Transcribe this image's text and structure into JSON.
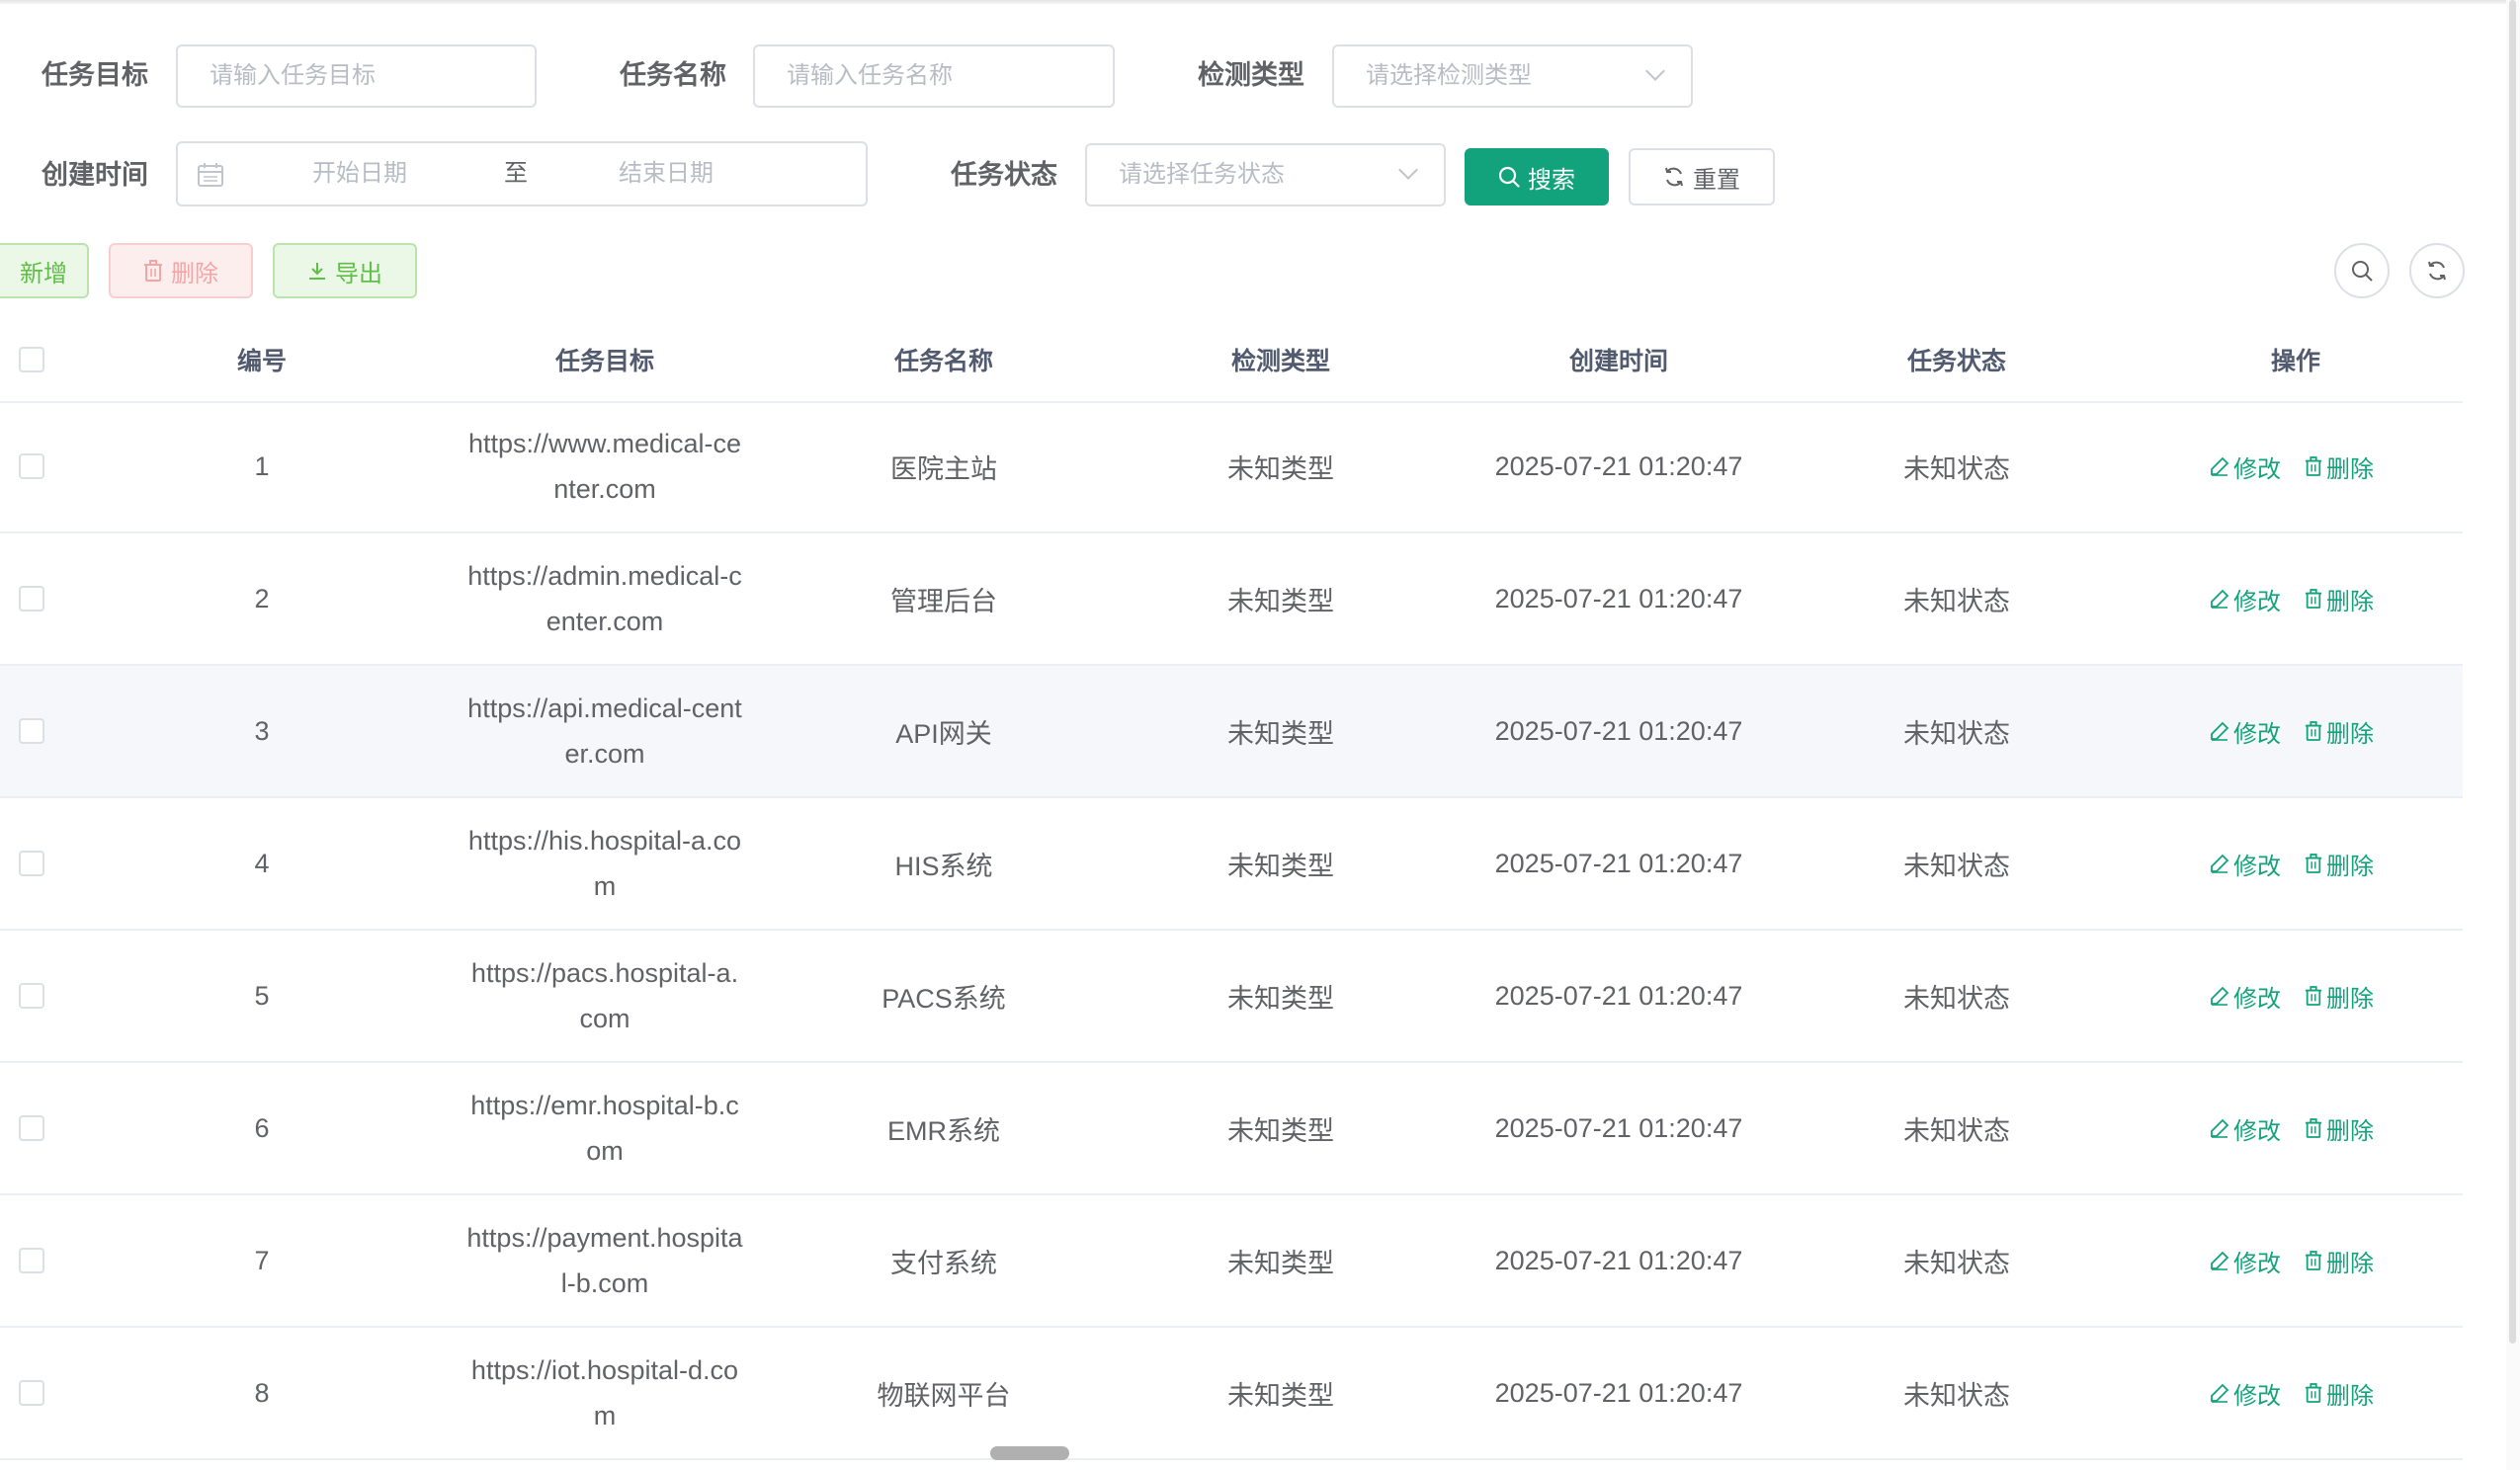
{
  "search_form": {
    "task_target_label": "任务目标",
    "task_target_placeholder": "请输入任务目标",
    "task_name_label": "任务名称",
    "task_name_placeholder": "请输入任务名称",
    "detect_type_label": "检测类型",
    "detect_type_placeholder": "请选择检测类型",
    "create_time_label": "创建时间",
    "start_date_placeholder": "开始日期",
    "range_separator": "至",
    "end_date_placeholder": "结束日期",
    "task_status_label": "任务状态",
    "task_status_placeholder": "请选择任务状态",
    "search_button": "搜索",
    "reset_button": "重置"
  },
  "toolbar": {
    "add_button": "新增",
    "delete_button": "删除",
    "export_button": "导出"
  },
  "table": {
    "columns": [
      "编号",
      "任务目标",
      "任务名称",
      "检测类型",
      "创建时间",
      "任务状态",
      "操作"
    ],
    "edit_label": "修改",
    "delete_label": "删除",
    "rows": [
      {
        "id": "1",
        "target": "https://www.medical-center.com",
        "target_lines": [
          "https://www.medical-ce",
          "nter.com"
        ],
        "name": "医院主站",
        "type": "未知类型",
        "created": "2025-07-21 01:20:47",
        "status": "未知状态"
      },
      {
        "id": "2",
        "target": "https://admin.medical-center.com",
        "target_lines": [
          "https://admin.medical-c",
          "enter.com"
        ],
        "name": "管理后台",
        "type": "未知类型",
        "created": "2025-07-21 01:20:47",
        "status": "未知状态"
      },
      {
        "id": "3",
        "target": "https://api.medical-center.com",
        "target_lines": [
          "https://api.medical-cent",
          "er.com"
        ],
        "name": "API网关",
        "type": "未知类型",
        "created": "2025-07-21 01:20:47",
        "status": "未知状态"
      },
      {
        "id": "4",
        "target": "https://his.hospital-a.com",
        "target_lines": [
          "https://his.hospital-a.co",
          "m"
        ],
        "name": "HIS系统",
        "type": "未知类型",
        "created": "2025-07-21 01:20:47",
        "status": "未知状态"
      },
      {
        "id": "5",
        "target": "https://pacs.hospital-a.com",
        "target_lines": [
          "https://pacs.hospital-a.",
          "com"
        ],
        "name": "PACS系统",
        "type": "未知类型",
        "created": "2025-07-21 01:20:47",
        "status": "未知状态"
      },
      {
        "id": "6",
        "target": "https://emr.hospital-b.com",
        "target_lines": [
          "https://emr.hospital-b.c",
          "om"
        ],
        "name": "EMR系统",
        "type": "未知类型",
        "created": "2025-07-21 01:20:47",
        "status": "未知状态"
      },
      {
        "id": "7",
        "target": "https://payment.hospital-b.com",
        "target_lines": [
          "https://payment.hospita",
          "l-b.com"
        ],
        "name": "支付系统",
        "type": "未知类型",
        "created": "2025-07-21 01:20:47",
        "status": "未知状态"
      },
      {
        "id": "8",
        "target": "https://iot.hospital-d.com",
        "target_lines": [
          "https://iot.hospital-d.co",
          "m"
        ],
        "name": "物联网平台",
        "type": "未知类型",
        "created": "2025-07-21 01:20:47",
        "status": "未知状态"
      }
    ]
  },
  "colors": {
    "primary": "#13a37c",
    "add_green": "#5fbe45",
    "delete_red": "#f5a5a5"
  },
  "icons": [
    "calendar-icon",
    "chevron-down-icon",
    "search-icon",
    "refresh-icon",
    "trash-icon",
    "download-icon",
    "edit-icon"
  ]
}
